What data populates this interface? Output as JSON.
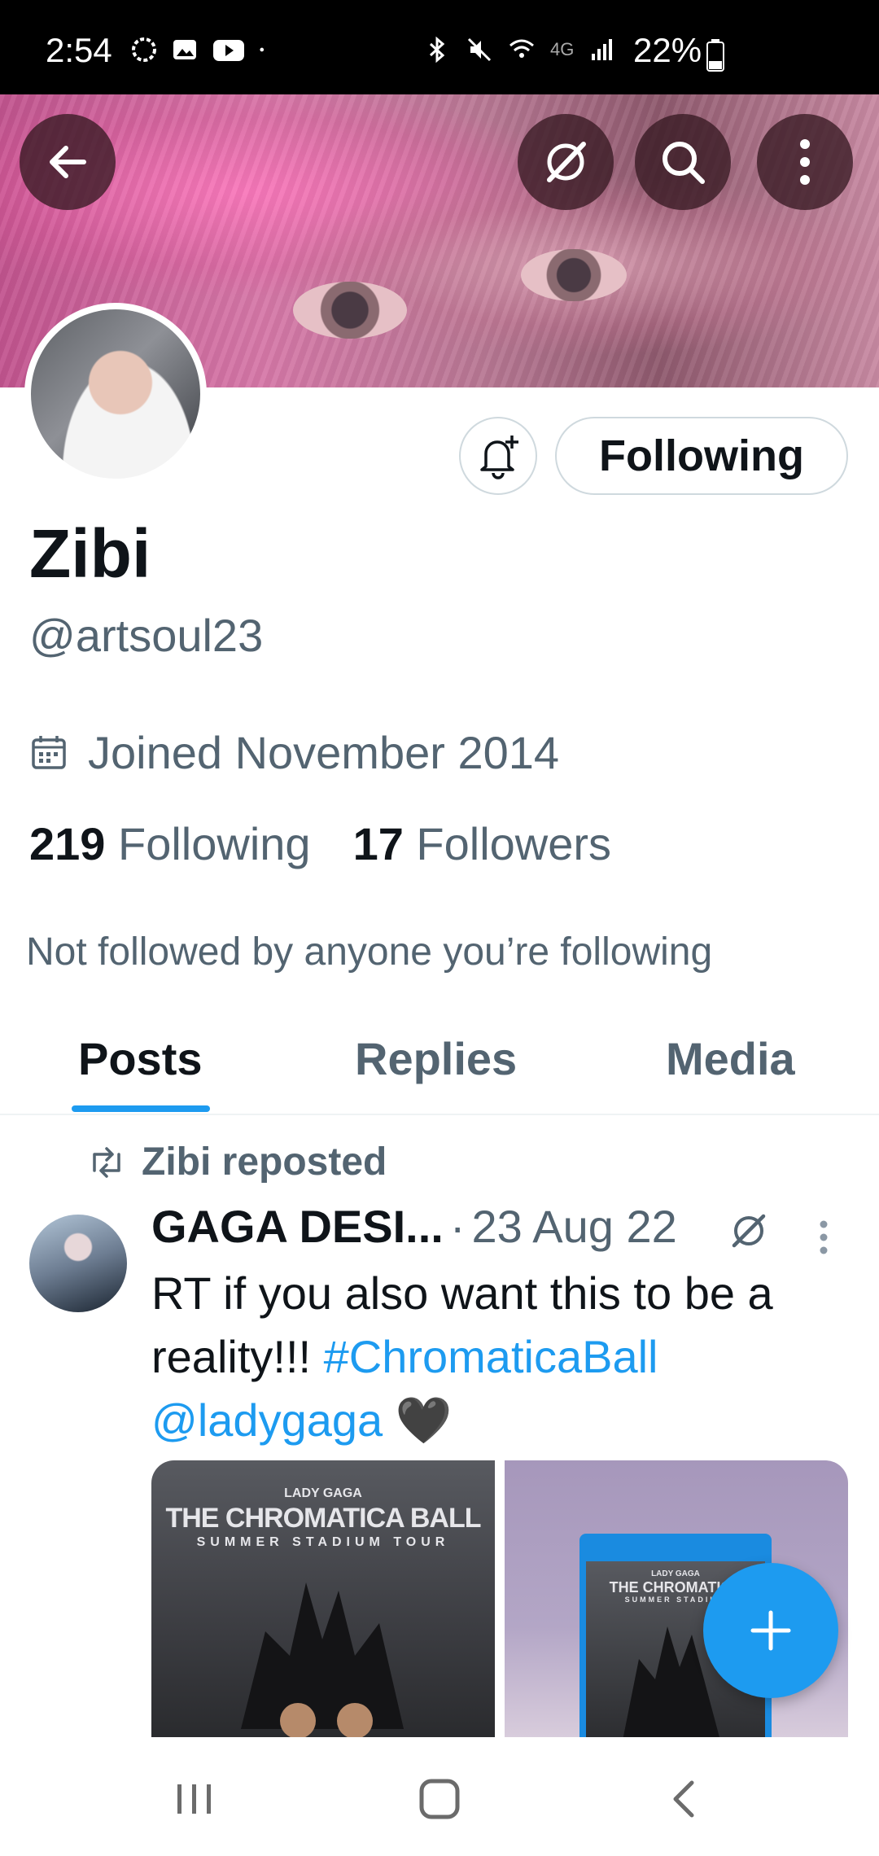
{
  "status_bar": {
    "time": "2:54",
    "battery": "22%",
    "network": "4G"
  },
  "profile": {
    "display_name": "Zibi",
    "handle": "@artsoul23",
    "joined": "Joined November 2014",
    "following_count": "219",
    "following_label": "Following",
    "followers_count": "17",
    "followers_label": "Followers",
    "not_followed_text": "Not followed by anyone you’re following",
    "follow_button_label": "Following"
  },
  "tabs": [
    {
      "label": "Posts",
      "active": true
    },
    {
      "label": "Replies",
      "active": false
    },
    {
      "label": "Media",
      "active": false
    }
  ],
  "post": {
    "repost_label": "Zibi reposted",
    "author": "GAGA DESI...",
    "separator": "·",
    "date": "23 Aug 22",
    "text_plain": "RT if you also want this to be a reality!!!",
    "hashtag": "#ChromaticaBall",
    "mention": "@ladygaga",
    "emoji": "🖤",
    "media": [
      {
        "top_text": "LADY GAGA",
        "title": "THE CHROMATICA BALL",
        "subtitle": "SUMMER STADIUM TOUR"
      },
      {
        "top_text": "LADY GAGA",
        "title": "THE CHROMATICA",
        "subtitle": "SUMMER STADIUM"
      }
    ]
  },
  "icons": {
    "back": "arrow-left-icon",
    "grok": "grok-icon",
    "search": "search-icon",
    "more": "more-vertical-icon",
    "bell": "bell-plus-icon",
    "calendar": "calendar-icon",
    "repost": "repost-icon",
    "compose": "plus-icon"
  },
  "colors": {
    "accent": "#1d9bf0",
    "secondary_text": "#536471",
    "primary_text": "#0f1419"
  }
}
